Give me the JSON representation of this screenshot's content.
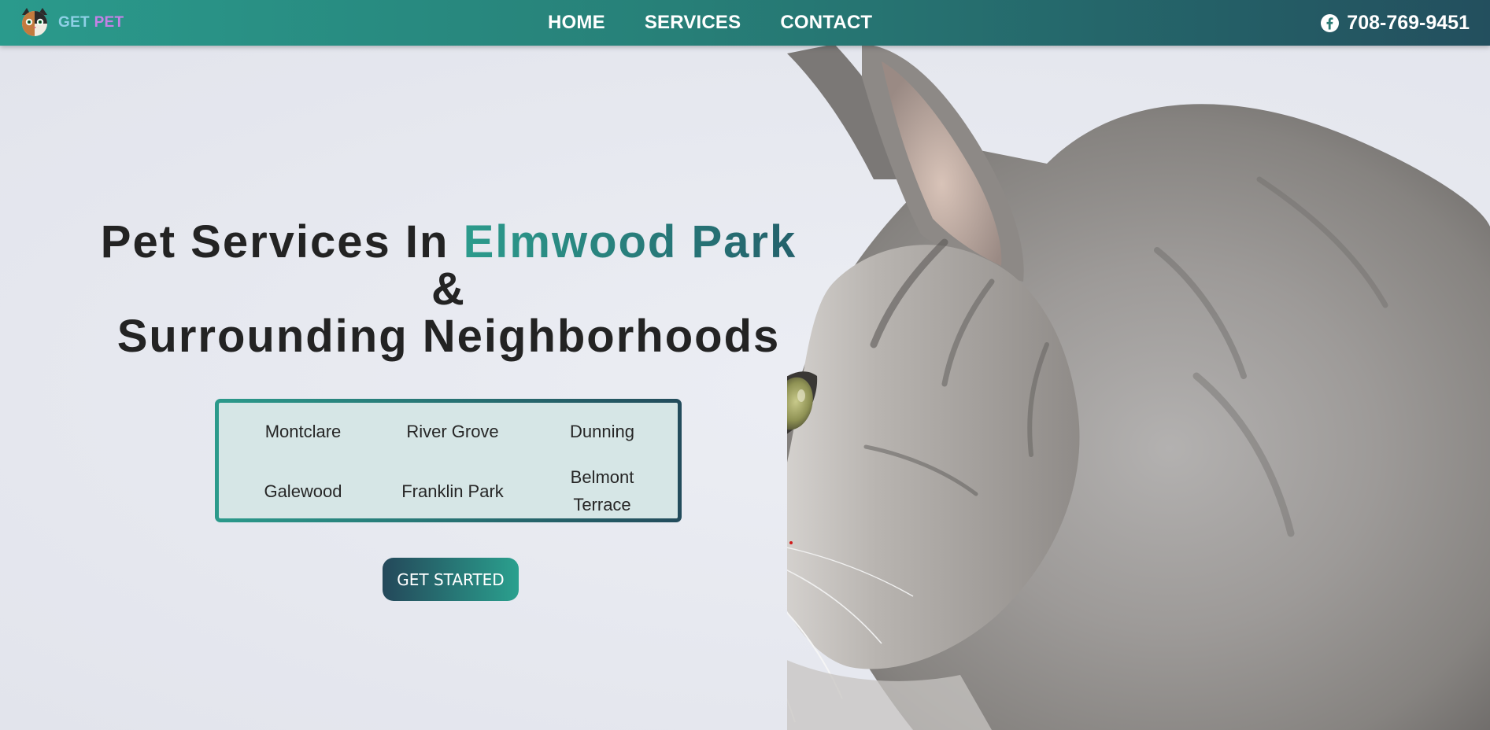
{
  "brand": {
    "get": "GET",
    "pet": "PET"
  },
  "nav": {
    "items": [
      "HOME",
      "SERVICES",
      "CONTACT"
    ]
  },
  "contact": {
    "phone": "708-769-9451",
    "icon": "facebook-icon"
  },
  "hero": {
    "line1_prefix": "Pet Services In ",
    "line1_accent": "Elmwood Park",
    "line2": "&",
    "line3": "Surrounding Neighborhoods",
    "areas": [
      "Montclare",
      "River Grove",
      "Dunning",
      "Galewood",
      "Franklin Park",
      "Belmont Terrace"
    ],
    "cta_label": "GET STARTED"
  },
  "colors": {
    "brand_teal": "#2a9a8c",
    "brand_dark": "#234f5e",
    "logo_get": "#8fd0e6",
    "logo_pet": "#c582e6",
    "heading": "#232323"
  }
}
